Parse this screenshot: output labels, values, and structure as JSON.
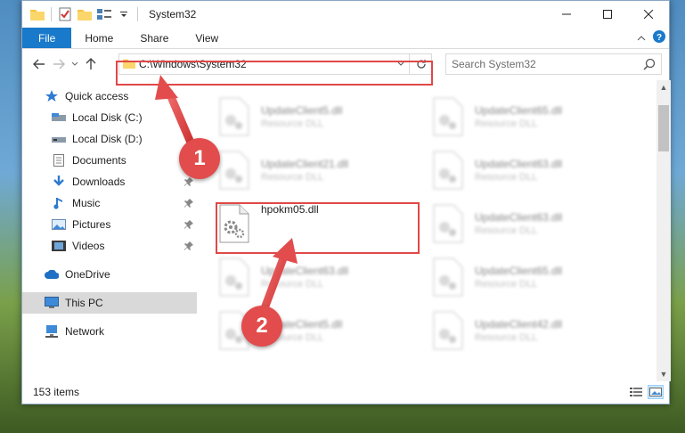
{
  "window": {
    "title": "System32"
  },
  "ribbon": {
    "tabs": [
      "File",
      "Home",
      "Share",
      "View"
    ]
  },
  "address": {
    "path": "C:\\Windows\\System32"
  },
  "search": {
    "placeholder": "Search System32"
  },
  "sidebar": {
    "items": [
      {
        "label": "Quick access",
        "icon": "star-icon",
        "pinned": false
      },
      {
        "label": "Local Disk (C:)",
        "icon": "drive-icon",
        "pinned": false
      },
      {
        "label": "Local Disk (D:)",
        "icon": "drive-icon",
        "pinned": false
      },
      {
        "label": "Documents",
        "icon": "document-icon",
        "pinned": true
      },
      {
        "label": "Downloads",
        "icon": "download-icon",
        "pinned": true
      },
      {
        "label": "Music",
        "icon": "music-icon",
        "pinned": true
      },
      {
        "label": "Pictures",
        "icon": "pictures-icon",
        "pinned": true
      },
      {
        "label": "Videos",
        "icon": "videos-icon",
        "pinned": true
      },
      {
        "label": "OneDrive",
        "icon": "cloud-icon",
        "pinned": false
      },
      {
        "label": "This PC",
        "icon": "computer-icon",
        "pinned": false
      },
      {
        "label": "Network",
        "icon": "network-icon",
        "pinned": false
      }
    ]
  },
  "files": [
    {
      "name": "UpdateClient5.dll",
      "type": "Resource DLL"
    },
    {
      "name": "UpdateClient65.dll",
      "type": "Resource DLL"
    },
    {
      "name": "UpdateClient21.dll",
      "type": "Resource DLL"
    },
    {
      "name": "UpdateClient63.dll",
      "type": "Resource DLL"
    },
    {
      "name": "hpokm05.dll",
      "type": ""
    },
    {
      "name": "UpdateClient63.dll",
      "type": "Resource DLL"
    },
    {
      "name": "UpdateClient63.dll",
      "type": "Resource DLL"
    },
    {
      "name": "UpdateClient65.dll",
      "type": "Resource DLL"
    },
    {
      "name": "UpdateClient5.dll",
      "type": "Resource DLL"
    },
    {
      "name": "UpdateClient42.dll",
      "type": "Resource DLL"
    }
  ],
  "status": {
    "item_count": "153 items"
  },
  "annotations": {
    "step1": "1",
    "step2": "2",
    "color": "#e24c4c"
  }
}
